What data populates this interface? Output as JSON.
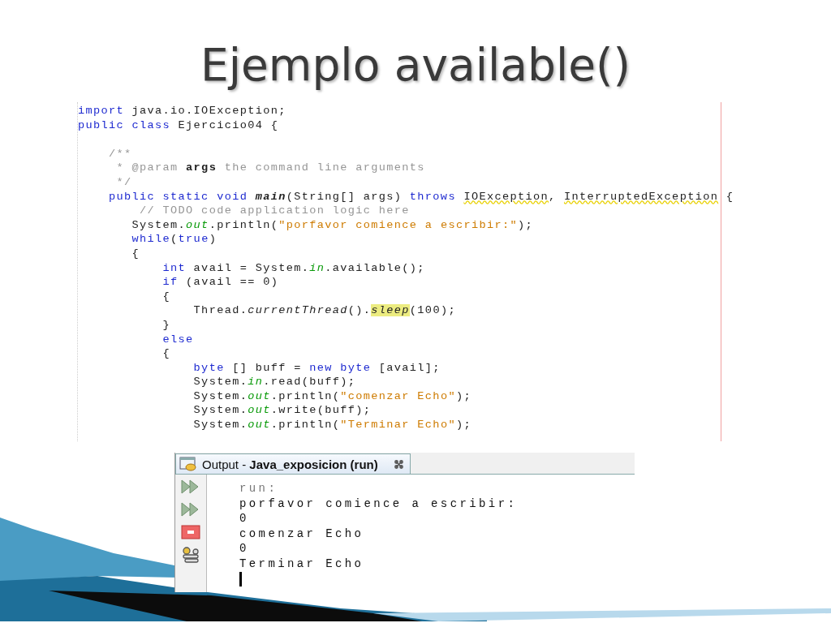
{
  "slide": {
    "title": "Ejemplo available()"
  },
  "code_editor": {
    "lines": [
      {
        "tokens": [
          {
            "kind": "kw",
            "text": "import"
          },
          {
            "kind": "plain",
            "text": " java.io.IOException;"
          }
        ]
      },
      {
        "tokens": [
          {
            "kind": "kw",
            "text": "public class"
          },
          {
            "kind": "plain",
            "text": " Ejercicio04 {"
          }
        ]
      },
      {
        "blank_before": true,
        "tokens": [
          {
            "kind": "comment",
            "text": "    /**"
          }
        ]
      },
      {
        "tokens": [
          {
            "kind": "comment",
            "text": "     * @param "
          },
          {
            "kind": "tag",
            "text": "args"
          },
          {
            "kind": "comment",
            "text": " the command line arguments"
          }
        ]
      },
      {
        "tokens": [
          {
            "kind": "comment",
            "text": "     */"
          }
        ]
      },
      {
        "tokens": [
          {
            "kind": "kw",
            "text": "    public static void "
          },
          {
            "kind": "method",
            "text": "main"
          },
          {
            "kind": "plain",
            "text": "(String[] args) "
          },
          {
            "kind": "kw",
            "text": "throws "
          },
          {
            "kind": "warn",
            "text": "IOException"
          },
          {
            "kind": "plain",
            "text": ", "
          },
          {
            "kind": "warn",
            "text": "InterruptedException"
          },
          {
            "kind": "plain",
            "text": " {"
          }
        ]
      },
      {
        "tokens": [
          {
            "kind": "comment",
            "text": "        // TODO code application logic here"
          }
        ]
      },
      {
        "tokens": [
          {
            "kind": "plain",
            "text": "       System."
          },
          {
            "kind": "field",
            "text": "out"
          },
          {
            "kind": "plain",
            "text": ".println("
          },
          {
            "kind": "string",
            "text": "\"porfavor comience a escribir:\""
          },
          {
            "kind": "plain",
            "text": ");"
          }
        ]
      },
      {
        "tokens": [
          {
            "kind": "kw",
            "text": "       while"
          },
          {
            "kind": "plain",
            "text": "("
          },
          {
            "kind": "kw",
            "text": "true"
          },
          {
            "kind": "plain",
            "text": ")"
          }
        ]
      },
      {
        "tokens": [
          {
            "kind": "plain",
            "text": "       {"
          }
        ]
      },
      {
        "tokens": [
          {
            "kind": "kw",
            "text": "           int"
          },
          {
            "kind": "plain",
            "text": " avail = System."
          },
          {
            "kind": "field",
            "text": "in"
          },
          {
            "kind": "plain",
            "text": ".available();"
          }
        ]
      },
      {
        "tokens": [
          {
            "kind": "kw",
            "text": "           if"
          },
          {
            "kind": "plain",
            "text": " (avail == 0)"
          }
        ]
      },
      {
        "tokens": [
          {
            "kind": "plain",
            "text": "           {"
          }
        ]
      },
      {
        "tokens": [
          {
            "kind": "plain",
            "text": "               Thread."
          },
          {
            "kind": "static",
            "text": "currentThread"
          },
          {
            "kind": "plain",
            "text": "()."
          },
          {
            "kind": "mark",
            "text": "sleep"
          },
          {
            "kind": "plain",
            "text": "(100);"
          }
        ]
      },
      {
        "tokens": [
          {
            "kind": "plain",
            "text": "           }"
          }
        ]
      },
      {
        "tokens": [
          {
            "kind": "kw",
            "text": "           else"
          }
        ]
      },
      {
        "tokens": [
          {
            "kind": "plain",
            "text": "           {"
          }
        ]
      },
      {
        "tokens": [
          {
            "kind": "kw",
            "text": "               byte"
          },
          {
            "kind": "plain",
            "text": " [] buff = "
          },
          {
            "kind": "kw",
            "text": "new byte"
          },
          {
            "kind": "plain",
            "text": " [avail];"
          }
        ]
      },
      {
        "tokens": [
          {
            "kind": "plain",
            "text": "               System."
          },
          {
            "kind": "field",
            "text": "in"
          },
          {
            "kind": "plain",
            "text": ".read(buff);"
          }
        ]
      },
      {
        "tokens": [
          {
            "kind": "plain",
            "text": "               System."
          },
          {
            "kind": "field",
            "text": "out"
          },
          {
            "kind": "plain",
            "text": ".println("
          },
          {
            "kind": "string",
            "text": "\"comenzar Echo\""
          },
          {
            "kind": "plain",
            "text": ");"
          }
        ]
      },
      {
        "tokens": [
          {
            "kind": "plain",
            "text": "               System."
          },
          {
            "kind": "field",
            "text": "out"
          },
          {
            "kind": "plain",
            "text": ".write(buff);"
          }
        ]
      },
      {
        "tokens": [
          {
            "kind": "plain",
            "text": "               System."
          },
          {
            "kind": "field",
            "text": "out"
          },
          {
            "kind": "plain",
            "text": ".println("
          },
          {
            "kind": "string",
            "text": "\"Terminar Echo\""
          },
          {
            "kind": "plain",
            "text": ");"
          }
        ]
      }
    ]
  },
  "output_panel": {
    "tab": {
      "label": "Output - **Java_exposicion (run)**",
      "selected": true
    },
    "toolbar": [
      {
        "kind": "rerun"
      },
      {
        "kind": "rerun"
      },
      {
        "kind": "stop"
      },
      {
        "kind": "settings"
      }
    ],
    "lines": [
      {
        "kind": "info",
        "text": "run:"
      },
      {
        "kind": "out",
        "text": "porfavor comience a escribir:"
      },
      {
        "kind": "out",
        "text": "0"
      },
      {
        "kind": "out",
        "text": "comenzar Echo"
      },
      {
        "kind": "out",
        "text": "0"
      },
      {
        "kind": "out",
        "text": "Terminar Echo"
      }
    ]
  }
}
